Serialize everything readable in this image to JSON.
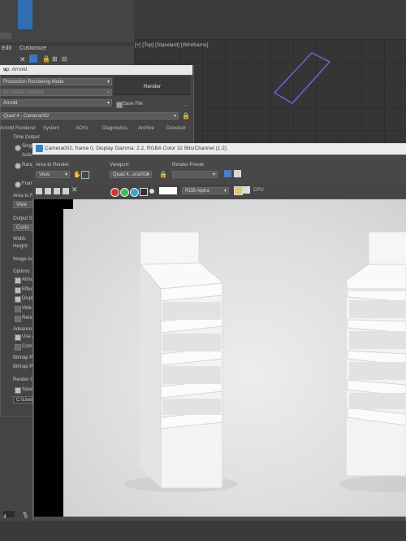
{
  "menu": {
    "items": [
      "Edit",
      "Customize"
    ]
  },
  "viewport": {
    "label": "[+] [Top] [Standard] [Wireframe]"
  },
  "render_setup": {
    "title": "up: Arnold",
    "target": "Production Rendering Mode",
    "preset": "No preset selected",
    "renderer": "Arnold",
    "view": "Quad 4 - Camera002",
    "render_button": "Render",
    "save_file": "Save File",
    "tabs": [
      "Arnold Renderer",
      "System",
      "AOVs",
      "Diagnostics",
      "Archive",
      "Denoiser"
    ],
    "time_output": "Time Output",
    "radio_labels": [
      "Singl",
      "Activ",
      "Rang",
      "Fram"
    ],
    "area_to_render": "Area to R",
    "view_value": "View",
    "output_size": "Output S",
    "custom": "Custo",
    "width": "Width:",
    "height": "Height:",
    "image_aspect": "Image As",
    "options": "Options",
    "option_items": [
      "Atmo",
      "Effec",
      "Displ",
      "Vide",
      "Rend"
    ],
    "advanced": "Advance",
    "adv_items": [
      "Use A",
      "Comp"
    ],
    "bitmap1": "Bitmap P",
    "bitmap2": "Bitmap P",
    "render_output": "Render O",
    "save": "Save",
    "path": "C:\\Users\\"
  },
  "frame_buffer": {
    "title": "Camera002, frame 0, Display Gamma: 2.2, RGBA Color 32 Bits/Channel (1:2)",
    "area_label": "Area to Render:",
    "area_value": "View",
    "viewport_label": "Viewport:",
    "viewport_value": "Quad 4...era002",
    "preset_label": "Render Preset:",
    "preset_value": "",
    "channel": "RGB Alpha",
    "cpu": "CPU"
  },
  "colors": {
    "red": "#d8353a",
    "green": "#3fbf4f",
    "blue": "#37a3d9",
    "selection": "#6e62d8"
  },
  "bottom": {
    "frame_numbers": [
      "4",
      "6"
    ]
  }
}
